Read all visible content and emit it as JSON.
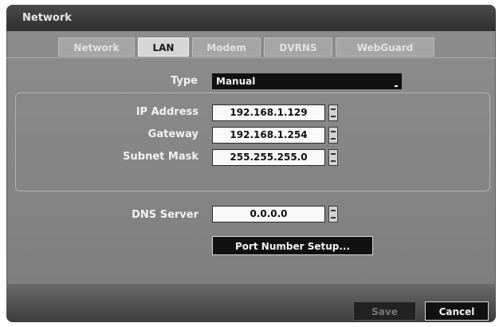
{
  "window": {
    "title": "Network"
  },
  "tabs": [
    {
      "label": "Network",
      "active": false
    },
    {
      "label": "LAN",
      "active": true
    },
    {
      "label": "Modem",
      "active": false
    },
    {
      "label": "DVRNS",
      "active": false
    },
    {
      "label": "WebGuard",
      "active": false
    }
  ],
  "type": {
    "label": "Type",
    "value": "Manual"
  },
  "ip": {
    "label": "IP Address",
    "value": "192.168.1.129"
  },
  "gateway": {
    "label": "Gateway",
    "value": "192.168.1.254"
  },
  "subnet": {
    "label": "Subnet Mask",
    "value": "255.255.255.0"
  },
  "dns": {
    "label": "DNS Server",
    "value": "0.0.0.0"
  },
  "buttons": {
    "port_setup": "Port Number Setup...",
    "save": "Save",
    "cancel": "Cancel"
  }
}
